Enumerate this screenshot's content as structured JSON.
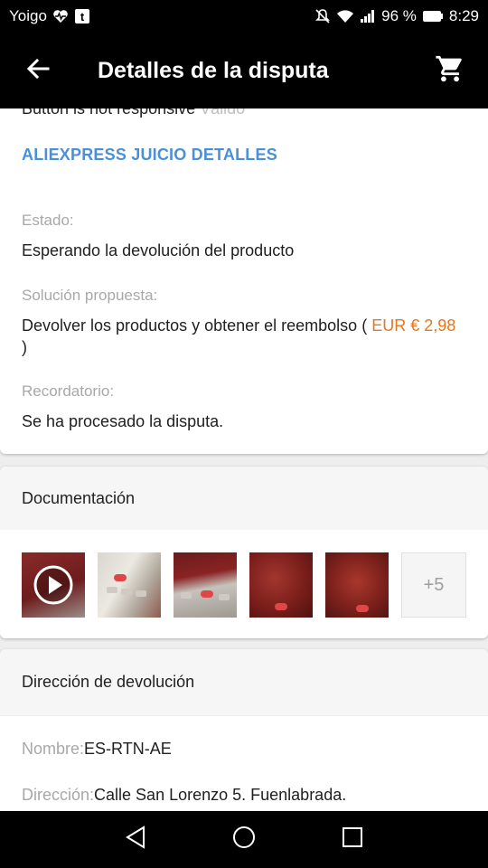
{
  "status_bar": {
    "carrier": "Yoigo",
    "battery": "96 %",
    "time": "8:29",
    "icons": [
      "heart-rate-icon",
      "tumblr-icon",
      "mute-icon",
      "wifi-icon",
      "signal-icon",
      "battery-icon"
    ]
  },
  "app_bar": {
    "title": "Detalles de la disputa",
    "back_icon": "arrow-back-icon",
    "cart_icon": "shopping-cart-icon"
  },
  "details": {
    "cut_line_text": "Button is not responsive",
    "cut_line_muted": "Válido",
    "section_link": "ALIEXPRESS JUICIO DETALLES",
    "estado_label": "Estado:",
    "estado_value": "Esperando la devolución del producto",
    "solucion_label": "Solución propuesta:",
    "solucion_value_prefix": "Devolver los productos y obtener el reembolso (",
    "solucion_amount": "EUR € 2,98",
    "solucion_value_suffix": ")",
    "recordatorio_label": "Recordatorio:",
    "recordatorio_value": "Se ha procesado la disputa."
  },
  "documentation": {
    "title": "Documentación",
    "more_label": "+5",
    "thumbnails": [
      "video",
      "photo",
      "photo",
      "photo",
      "photo"
    ]
  },
  "return_address": {
    "title": "Dirección de devolución",
    "name_label": "Nombre:",
    "name_value": "ES-RTN-AE",
    "address_label": "Dirección:",
    "address_value": "Calle San Lorenzo 5. Fuenlabrada."
  },
  "nav_bar": {
    "icons": [
      "nav-back-icon",
      "nav-home-icon",
      "nav-recents-icon"
    ]
  },
  "colors": {
    "link_blue": "#4a90d9",
    "price_orange": "#e6761f",
    "label_gray": "#a8a8a8"
  }
}
